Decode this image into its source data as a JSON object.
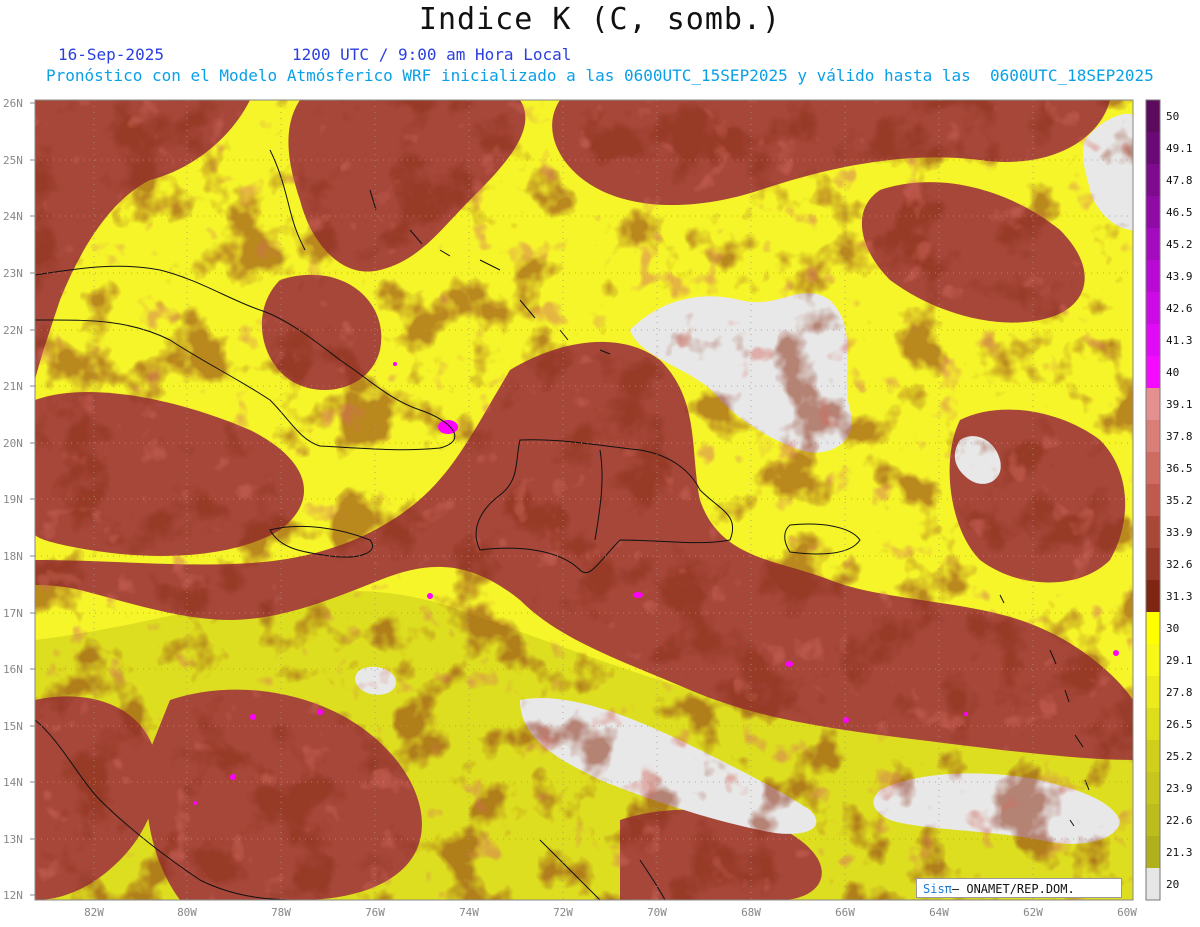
{
  "header": {
    "title": "Indice K (C, somb.)",
    "date": "16-Sep-2025",
    "time": "1200 UTC / 9:00 am Hora Local",
    "model_info": "Pronóstico con el Modelo Atmósferico WRF inicializado a las 0600UTC_15SEP2025 y válido hasta las  0600UTC_18SEP2025"
  },
  "map": {
    "lat_labels": [
      "26N",
      "25N",
      "24N",
      "23N",
      "22N",
      "21N",
      "20N",
      "19N",
      "18N",
      "17N",
      "16N",
      "15N",
      "14N",
      "13N",
      "12N"
    ],
    "lon_labels": [
      "82W",
      "80W",
      "78W",
      "76W",
      "74W",
      "72W",
      "70W",
      "68W",
      "66W",
      "64W",
      "62W",
      "60W"
    ],
    "colors": {
      "below_20": "#e8e8e8",
      "yellow_dark": "#c8c619",
      "yellow": "#ffff33",
      "brown_dark": "#8b3018",
      "brown": "#a8483a",
      "salmon": "#d66c63",
      "magenta": "#ff00ff",
      "purple": "#800080",
      "coast": "#111111"
    }
  },
  "colorbar": {
    "labels": [
      "50",
      "49.1",
      "47.8",
      "46.5",
      "45.2",
      "43.9",
      "42.6",
      "41.3",
      "40",
      "39.1",
      "37.8",
      "36.5",
      "35.2",
      "33.9",
      "32.6",
      "31.3",
      "30",
      "29.1",
      "27.8",
      "26.5",
      "25.2",
      "23.9",
      "22.6",
      "21.3",
      "20"
    ],
    "colors": [
      "#5c0a5c",
      "#6a0a74",
      "#7e0a8e",
      "#900aa6",
      "#a40abe",
      "#b80ad4",
      "#cc0ae6",
      "#e00af4",
      "#f40aff",
      "#e59090",
      "#da7e78",
      "#cf6c62",
      "#c05a4e",
      "#aa4838",
      "#963828",
      "#7e2612",
      "#ffff00",
      "#f7f71a",
      "#eaea1c",
      "#dddd1c",
      "#d0d01c",
      "#c6c61e",
      "#bcbc1c",
      "#b0b01c",
      "#e6e6e6"
    ]
  },
  "credit": {
    "brand": "SisPI",
    "org": "ONAMET/REP.DOM."
  }
}
